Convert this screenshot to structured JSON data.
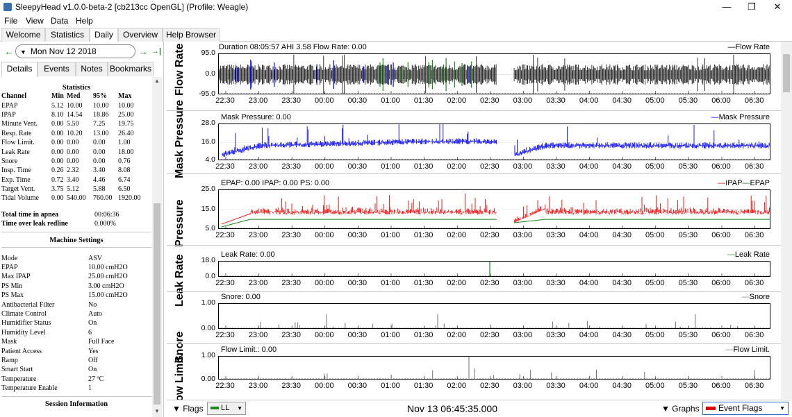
{
  "window": {
    "title": "SleepyHead v1.0.0-beta-2 [cb213cc OpenGL] (Profile: Weagle)",
    "minimize": "—",
    "maximize": "❐",
    "close": "✕"
  },
  "menu": [
    "File",
    "View",
    "Data",
    "Help"
  ],
  "main_tabs": [
    "Welcome",
    "Statistics",
    "Daily",
    "Overview",
    "Help Browser"
  ],
  "active_main_tab": "Daily",
  "date_nav": {
    "date": "Mon Nov 12 2018",
    "prev": "←",
    "next": "→",
    "last": "→|"
  },
  "sub_tabs": [
    "Details",
    "Events",
    "Notes",
    "Bookmarks"
  ],
  "statistics": {
    "heading": "Statistics",
    "columns": [
      "Channel",
      "Min",
      "Med",
      "95%",
      "Max"
    ],
    "rows": [
      [
        "EPAP",
        "5.12",
        "10.00",
        "10.00",
        "10.00"
      ],
      [
        "IPAP",
        "8.10",
        "14.54",
        "18.86",
        "25.00"
      ],
      [
        "Minute Vent.",
        "0.00",
        "5.50",
        "7.25",
        "19.75"
      ],
      [
        "Resp. Rate",
        "0.00",
        "10.20",
        "13.00",
        "26.40"
      ],
      [
        "Flow Limit.",
        "0.00",
        "0.00",
        "0.00",
        "1.00"
      ],
      [
        "Leak Rate",
        "0.00",
        "0.00",
        "0.00",
        "18.00"
      ],
      [
        "Snore",
        "0.00",
        "0.00",
        "0.00",
        "0.76"
      ],
      [
        "Insp. Time",
        "0.26",
        "2.32",
        "3.40",
        "8.08"
      ],
      [
        "Exp. Time",
        "0.72",
        "3.40",
        "4.46",
        "6.74"
      ],
      [
        "Target Vent.",
        "3.75",
        "5.12",
        "5.88",
        "6.50"
      ],
      [
        "Tidal Volume",
        "0.00",
        "540.00",
        "760.00",
        "1920.00"
      ]
    ],
    "apnea_label": "Total time in apnea",
    "apnea_value": "00:06:36",
    "leak_label": "Time over leak redline",
    "leak_value": "0.000%"
  },
  "machine_settings": {
    "heading": "Machine Settings",
    "rows": [
      [
        "Mode",
        "ASV"
      ],
      [
        "EPAP",
        "10.00 cmH2O"
      ],
      [
        "Max IPAP",
        "25.00 cmH2O"
      ],
      [
        "PS Min",
        "3.00 cmH2O"
      ],
      [
        "PS Max",
        "15.00 cmH2O"
      ],
      [
        "Antibacterial Filter",
        "No"
      ],
      [
        "Climate Control",
        "Auto"
      ],
      [
        "Humidifier Status",
        "On"
      ],
      [
        "Humidity Level",
        "6"
      ],
      [
        "Mask",
        "Full Face"
      ],
      [
        "Patient Access",
        "Yes"
      ],
      [
        "Ramp",
        "Off"
      ],
      [
        "Smart Start",
        "On"
      ],
      [
        "Temperature",
        "27 ºC"
      ],
      [
        "Temperature Enable",
        "1"
      ]
    ]
  },
  "session_information": "Session Information",
  "x_ticks": [
    "22:30",
    "23:00",
    "23:30",
    "00:00",
    "00:30",
    "01:00",
    "01:30",
    "02:00",
    "02:30",
    "03:00",
    "03:30",
    "04:00",
    "04:30",
    "05:00",
    "05:30",
    "06:00",
    "06:30"
  ],
  "graphs": [
    {
      "name": "Flow Rate",
      "title": "Duration 08:05:57 AHI 3.58 Flow Rate: 0.00",
      "legend": "Flow Rate",
      "legend_color": "#000000",
      "yticks": [
        "95.0",
        "0.0",
        "-95.0"
      ]
    },
    {
      "name": "Mask Pressure",
      "title": "Mask Pressure: 0.00",
      "legend": "Mask Pressure",
      "legend_color": "#0000ff",
      "yticks": [
        "28.0",
        "16.0",
        "4.0"
      ]
    },
    {
      "name": "Pressure",
      "title": "EPAP: 0.00 IPAP: 0.00 PS: 0.00",
      "legend": "IPAP",
      "legend2": "EPAP",
      "legend_color": "#ff0000",
      "legend2_color": "#1a8a1a",
      "yticks": [
        "25.0",
        "15.0",
        "5.0"
      ]
    },
    {
      "name": "Leak Rate",
      "title": "Leak Rate: 0.00",
      "legend": "Leak Rate",
      "legend_color": "#1a8a1a",
      "yticks": [
        "18.0",
        "0.0"
      ]
    },
    {
      "name": "Snore",
      "title": "Snore: 0.00",
      "legend": "Snore",
      "legend_color": "#808080",
      "yticks": [
        "1.00",
        "0.00"
      ]
    },
    {
      "name": "Flow Limit.",
      "title": "Flow Limit.: 0.00",
      "legend": "Flow Limit.",
      "legend_color": "#808080",
      "yticks": [
        "1.00",
        "0.00"
      ]
    }
  ],
  "bottom_bar": {
    "flags_label": "Flags",
    "ll_label": "LL",
    "time": "Nov 13 06:45:35.000",
    "graphs_label": "Graphs",
    "event_flags": "Event Flags"
  }
}
